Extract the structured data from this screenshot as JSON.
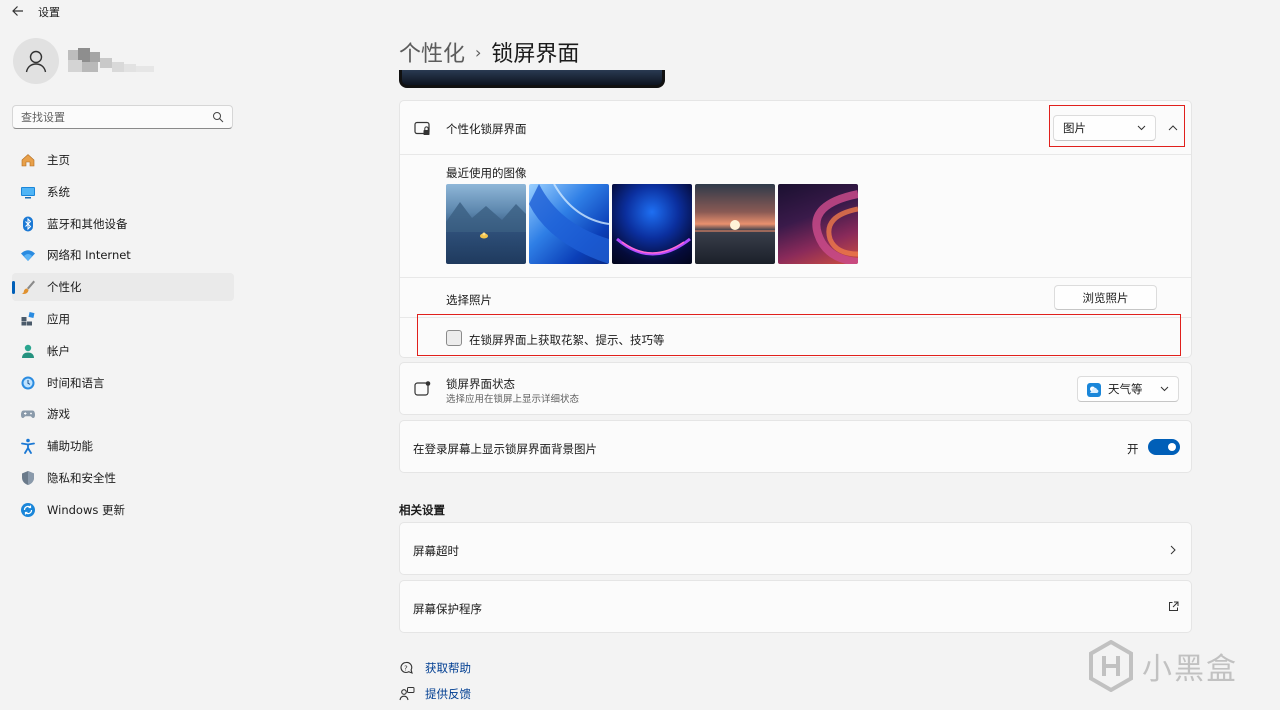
{
  "app": {
    "title": "设置"
  },
  "sidebar": {
    "search_placeholder": "查找设置",
    "items": [
      {
        "label": "主页",
        "icon": "home-icon"
      },
      {
        "label": "系统",
        "icon": "system-monitor-icon"
      },
      {
        "label": "蓝牙和其他设备",
        "icon": "bluetooth-icon"
      },
      {
        "label": "网络和 Internet",
        "icon": "wifi-icon"
      },
      {
        "label": "个性化",
        "icon": "brush-icon",
        "active": true
      },
      {
        "label": "应用",
        "icon": "apps-icon"
      },
      {
        "label": "帐户",
        "icon": "account-icon"
      },
      {
        "label": "时间和语言",
        "icon": "time-language-icon"
      },
      {
        "label": "游戏",
        "icon": "gamepad-icon"
      },
      {
        "label": "辅助功能",
        "icon": "accessibility-icon"
      },
      {
        "label": "隐私和安全性",
        "icon": "shield-icon"
      },
      {
        "label": "Windows 更新",
        "icon": "windows-update-icon"
      }
    ]
  },
  "breadcrumb": {
    "parent": "个性化",
    "separator": "›",
    "current": "锁屏界面"
  },
  "lockscreen": {
    "title": "个性化锁屏界面",
    "dropdown_value": "图片",
    "recent_label": "最近使用的图像",
    "choose_photo_label": "选择照片",
    "browse_button": "浏览照片",
    "tips_checkbox_label": "在锁屏界面上获取花絮、提示、技巧等",
    "tips_checked": false
  },
  "status": {
    "title": "锁屏界面状态",
    "subtitle": "选择应用在锁屏上显示详细状态",
    "dropdown_value": "天气等"
  },
  "signin": {
    "title": "在登录屏幕上显示锁屏界面背景图片",
    "toggle_label": "开",
    "toggle_on": true
  },
  "related": {
    "heading": "相关设置",
    "items": [
      {
        "label": "屏幕超时",
        "icon": "chevron-right-icon"
      },
      {
        "label": "屏幕保护程序",
        "icon": "external-link-icon"
      }
    ]
  },
  "help": {
    "get_help": "获取帮助",
    "feedback": "提供反馈"
  },
  "watermark": {
    "text": "小黑盒"
  },
  "colors": {
    "accent": "#005fb8",
    "highlight_box": "#e0201c",
    "background": "#f3f3f3"
  }
}
